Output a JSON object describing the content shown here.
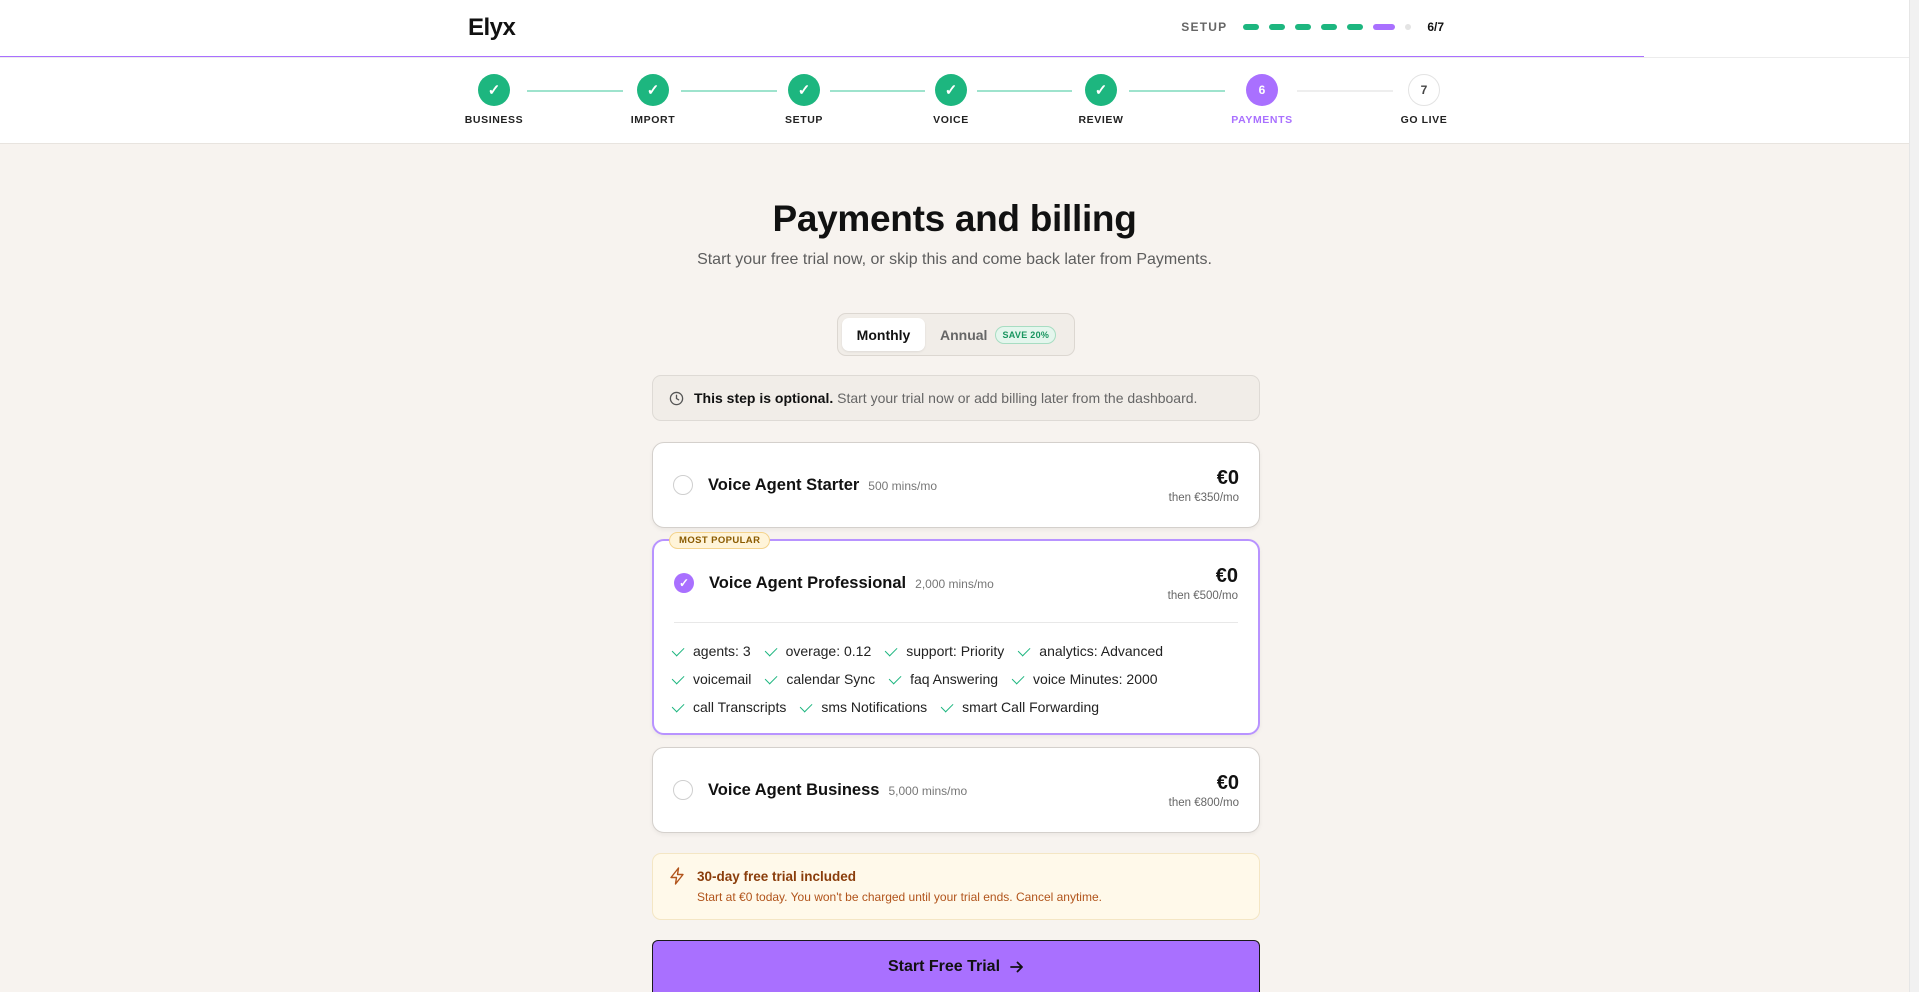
{
  "brand": "Elyx",
  "setup": {
    "label": "SETUP",
    "count": "6/7"
  },
  "steps": [
    {
      "label": "BUSINESS",
      "state": "done"
    },
    {
      "label": "IMPORT",
      "state": "done"
    },
    {
      "label": "SETUP",
      "state": "done"
    },
    {
      "label": "VOICE",
      "state": "done"
    },
    {
      "label": "REVIEW",
      "state": "done"
    },
    {
      "label": "PAYMENTS",
      "state": "current",
      "number": "6"
    },
    {
      "label": "GO LIVE",
      "state": "todo",
      "number": "7"
    }
  ],
  "page": {
    "title": "Payments and billing",
    "subtitle": "Start your free trial now, or skip this and come back later from Payments."
  },
  "billing_toggle": {
    "monthly": "Monthly",
    "annual": "Annual",
    "save_badge": "SAVE 20%",
    "selected": "Monthly"
  },
  "optional_notice": {
    "bold": "This step is optional.",
    "text": "Start your trial now or add billing later from the dashboard."
  },
  "plans": [
    {
      "name": "Voice Agent Starter",
      "mins": "500 mins/mo",
      "price": "€0",
      "then": "then €350/mo",
      "selected": false
    },
    {
      "name": "Voice Agent Professional",
      "mins": "2,000 mins/mo",
      "price": "€0",
      "then": "then €500/mo",
      "selected": true,
      "badge": "MOST POPULAR",
      "features": [
        [
          "agents: 3",
          "overage: 0.12",
          "support: Priority",
          "analytics: Advanced"
        ],
        [
          "voicemail",
          "calendar Sync",
          "faq Answering",
          "voice Minutes: 2000"
        ],
        [
          "call Transcripts",
          "sms Notifications",
          "smart Call Forwarding"
        ]
      ]
    },
    {
      "name": "Voice Agent Business",
      "mins": "5,000 mins/mo",
      "price": "€0",
      "then": "then €800/mo",
      "selected": false
    }
  ],
  "trial": {
    "title": "30-day free trial included",
    "text": "Start at €0 today. You won't be charged until your trial ends. Cancel anytime."
  },
  "cta": {
    "label": "Start Free Trial"
  },
  "colors": {
    "accent": "#a970ff",
    "success": "#1db67f",
    "background": "#f7f3ef"
  }
}
